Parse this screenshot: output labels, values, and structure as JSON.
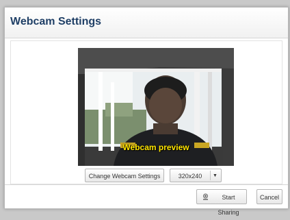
{
  "dialog": {
    "title": "Webcam Settings",
    "preview_label": "Webcam preview",
    "change_settings_label": "Change Webcam Settings",
    "resolution": {
      "selected": "320x240"
    },
    "start_sharing_label": "Start Sharing",
    "cancel_label": "Cancel"
  },
  "icons": {
    "start_sharing": "webcam-icon",
    "dropdown": "chevron-down-icon"
  }
}
